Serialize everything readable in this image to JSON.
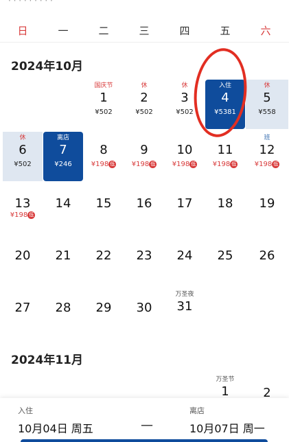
{
  "top_cut_text": "· · · · · · · · ·",
  "weekdays": [
    "日",
    "一",
    "二",
    "三",
    "四",
    "五",
    "六"
  ],
  "october": {
    "title": "2024年10月",
    "cells": [
      {
        "tag": "国庆节",
        "day": "1",
        "price": "¥502"
      },
      {
        "tag": "休",
        "day": "2",
        "price": "¥502"
      },
      {
        "tag": "休",
        "day": "3",
        "price": "¥502"
      },
      {
        "tag": "入住",
        "day": "4",
        "price": "¥5381"
      },
      {
        "tag": "休",
        "day": "5",
        "price": "¥558"
      },
      {
        "tag": "休",
        "day": "6",
        "price": "¥502"
      },
      {
        "tag": "离店",
        "day": "7",
        "price": "¥246"
      },
      {
        "tag": "",
        "day": "8",
        "price": "¥198",
        "low": "低"
      },
      {
        "tag": "",
        "day": "9",
        "price": "¥198",
        "low": "低"
      },
      {
        "tag": "",
        "day": "10",
        "price": "¥198",
        "low": "低"
      },
      {
        "tag": "",
        "day": "11",
        "price": "¥198",
        "low": "低"
      },
      {
        "tag": "班",
        "day": "12",
        "price": "¥198",
        "low": "低"
      },
      {
        "tag": "",
        "day": "13",
        "price": "¥198",
        "low": "低"
      },
      {
        "tag": "",
        "day": "14",
        "price": ""
      },
      {
        "tag": "",
        "day": "15",
        "price": ""
      },
      {
        "tag": "",
        "day": "16",
        "price": ""
      },
      {
        "tag": "",
        "day": "17",
        "price": ""
      },
      {
        "tag": "",
        "day": "18",
        "price": ""
      },
      {
        "tag": "",
        "day": "19",
        "price": ""
      },
      {
        "tag": "",
        "day": "20",
        "price": ""
      },
      {
        "tag": "",
        "day": "21",
        "price": ""
      },
      {
        "tag": "",
        "day": "22",
        "price": ""
      },
      {
        "tag": "",
        "day": "23",
        "price": ""
      },
      {
        "tag": "",
        "day": "24",
        "price": ""
      },
      {
        "tag": "",
        "day": "25",
        "price": ""
      },
      {
        "tag": "",
        "day": "26",
        "price": ""
      },
      {
        "tag": "",
        "day": "27",
        "price": ""
      },
      {
        "tag": "",
        "day": "28",
        "price": ""
      },
      {
        "tag": "",
        "day": "29",
        "price": ""
      },
      {
        "tag": "",
        "day": "30",
        "price": ""
      },
      {
        "tag": "万圣夜",
        "day": "31",
        "price": ""
      }
    ]
  },
  "november": {
    "title": "2024年11月",
    "cells": [
      {
        "tag": "万圣节",
        "day": "1"
      },
      {
        "tag": "",
        "day": "2"
      }
    ]
  },
  "bottom": {
    "checkin_label": "入住",
    "checkin_date": "10月04日 周五",
    "dash": "—",
    "checkout_label": "离店",
    "checkout_date": "10月07日 周一"
  },
  "colors": {
    "selected": "#0f4c9c",
    "rest": "#dfe7f1",
    "holiday_red": "#d83a3a",
    "annotation_circle": "#e22e22"
  }
}
